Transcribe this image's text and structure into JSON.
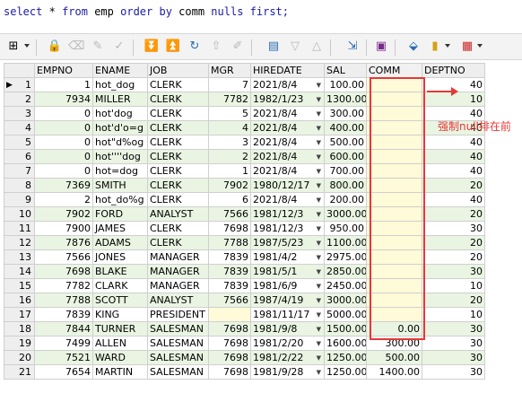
{
  "sql": {
    "kw_select": "select",
    "star": "*",
    "kw_from": "from",
    "table": "emp",
    "kw_order_by": "order by",
    "column": "comm",
    "kw_nulls_first": "nulls first;"
  },
  "toolbar": {
    "icons": [
      "grid-icon",
      "lock-icon",
      "eraser-icon",
      "clear-icon",
      "check-icon",
      "first-icon",
      "last-icon",
      "refresh-icon",
      "up-icon",
      "edit-icon",
      "record-icon",
      "filter-icon",
      "sort-icon",
      "query-by-example-icon",
      "save-icon",
      "export-icon",
      "chart-icon",
      "view-icon"
    ]
  },
  "grid": {
    "columns": [
      "",
      "EMPNO",
      "ENAME",
      "JOB",
      "MGR",
      "HIREDATE",
      "SAL",
      "COMM",
      "DEPTNO"
    ],
    "rows": [
      [
        "1",
        "1",
        "hot_dog",
        "CLERK",
        "7",
        "2021/8/4",
        "100.00",
        "",
        "40"
      ],
      [
        "2",
        "7934",
        "MILLER",
        "CLERK",
        "7782",
        "1982/1/23",
        "1300.00",
        "",
        "10"
      ],
      [
        "3",
        "0",
        "hot'dog",
        "CLERK",
        "5",
        "2021/8/4",
        "300.00",
        "",
        "40"
      ],
      [
        "4",
        "0",
        "hot'd'o=g",
        "CLERK",
        "4",
        "2021/8/4",
        "400.00",
        "",
        "40"
      ],
      [
        "5",
        "0",
        "hot\"d%og",
        "CLERK",
        "3",
        "2021/8/4",
        "500.00",
        "",
        "40"
      ],
      [
        "6",
        "0",
        "hot''''dog",
        "CLERK",
        "2",
        "2021/8/4",
        "600.00",
        "",
        "40"
      ],
      [
        "7",
        "0",
        "hot=dog",
        "CLERK",
        "1",
        "2021/8/4",
        "700.00",
        "",
        "40"
      ],
      [
        "8",
        "7369",
        "SMITH",
        "CLERK",
        "7902",
        "1980/12/17",
        "800.00",
        "",
        "20"
      ],
      [
        "9",
        "2",
        "hot_do%g",
        "CLERK",
        "6",
        "2021/8/4",
        "200.00",
        "",
        "40"
      ],
      [
        "10",
        "7902",
        "FORD",
        "ANALYST",
        "7566",
        "1981/12/3",
        "3000.00",
        "",
        "20"
      ],
      [
        "11",
        "7900",
        "JAMES",
        "CLERK",
        "7698",
        "1981/12/3",
        "950.00",
        "",
        "30"
      ],
      [
        "12",
        "7876",
        "ADAMS",
        "CLERK",
        "7788",
        "1987/5/23",
        "1100.00",
        "",
        "20"
      ],
      [
        "13",
        "7566",
        "JONES",
        "MANAGER",
        "7839",
        "1981/4/2",
        "2975.00",
        "",
        "20"
      ],
      [
        "14",
        "7698",
        "BLAKE",
        "MANAGER",
        "7839",
        "1981/5/1",
        "2850.00",
        "",
        "30"
      ],
      [
        "15",
        "7782",
        "CLARK",
        "MANAGER",
        "7839",
        "1981/6/9",
        "2450.00",
        "",
        "10"
      ],
      [
        "16",
        "7788",
        "SCOTT",
        "ANALYST",
        "7566",
        "1987/4/19",
        "3000.00",
        "",
        "20"
      ],
      [
        "17",
        "7839",
        "KING",
        "PRESIDENT",
        "",
        "1981/11/17",
        "5000.00",
        "",
        "10"
      ],
      [
        "18",
        "7844",
        "TURNER",
        "SALESMAN",
        "7698",
        "1981/9/8",
        "1500.00",
        "0.00",
        "30"
      ],
      [
        "19",
        "7499",
        "ALLEN",
        "SALESMAN",
        "7698",
        "1981/2/20",
        "1600.00",
        "300.00",
        "30"
      ],
      [
        "20",
        "7521",
        "WARD",
        "SALESMAN",
        "7698",
        "1981/2/22",
        "1250.00",
        "500.00",
        "30"
      ],
      [
        "21",
        "7654",
        "MARTIN",
        "SALESMAN",
        "7698",
        "1981/9/28",
        "1250.00",
        "1400.00",
        "30"
      ]
    ]
  },
  "annotation": {
    "text": "强制null排在前",
    "color": "#e53838"
  },
  "colors": {
    "keyword": "#1a1aa6",
    "row_alt": "#e9f5e2",
    "comm_empty": "#fffad7",
    "highlight_box": "#e53838"
  }
}
